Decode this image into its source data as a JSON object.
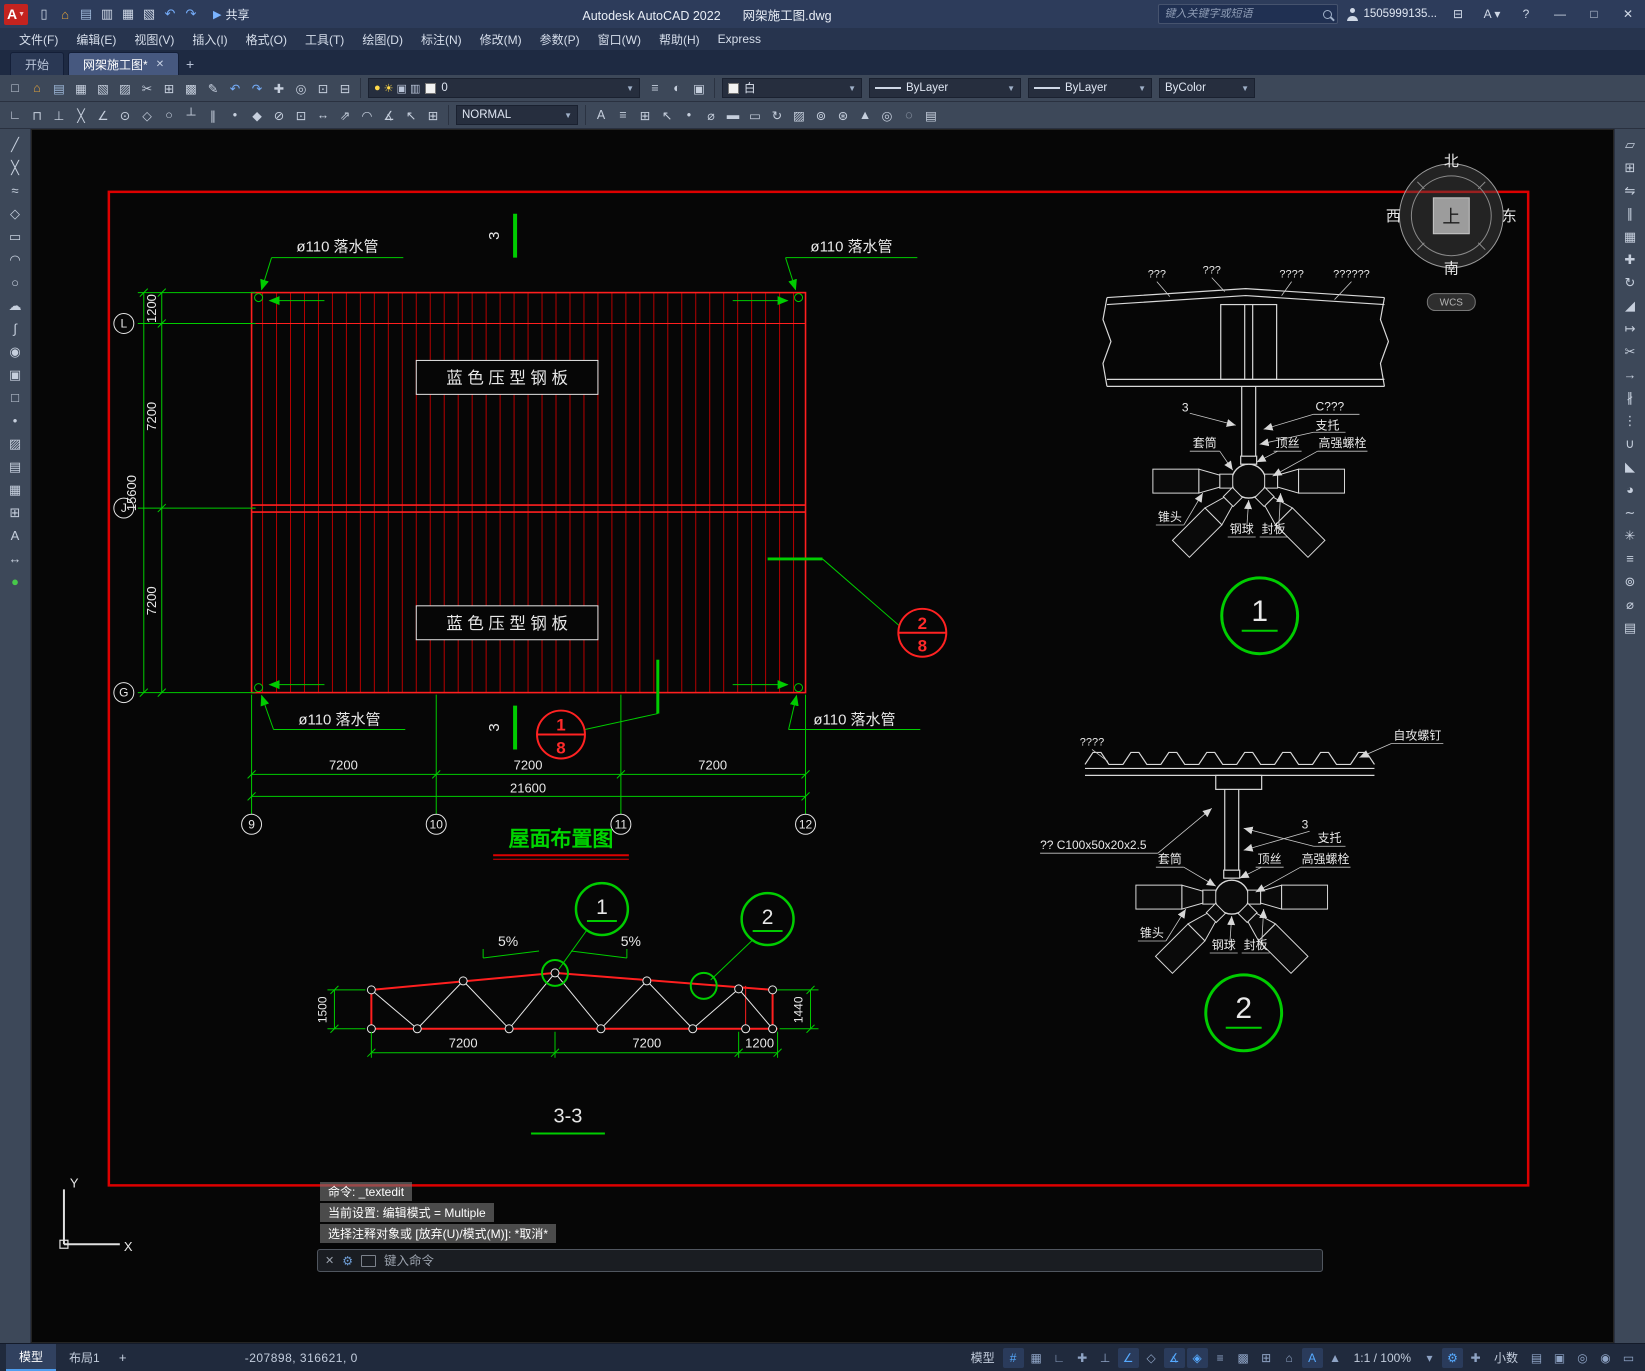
{
  "titlebar": {
    "logo": "A",
    "qat_icons": [
      {
        "name": "qnew-icon",
        "glyph": "▯"
      },
      {
        "name": "open-file-icon",
        "glyph": "⌂",
        "style": "color:#e0a23c"
      },
      {
        "name": "save-icon",
        "glyph": "▤",
        "style": "color:#9db7d8"
      },
      {
        "name": "save-all-icon",
        "glyph": "▥"
      },
      {
        "name": "plot-icon",
        "glyph": "▦"
      },
      {
        "name": "preview-icon",
        "glyph": "▧"
      },
      {
        "name": "undo-icon",
        "glyph": "↶",
        "style": "color:#76aefb"
      },
      {
        "name": "redo-icon",
        "glyph": "↷",
        "style": "color:#76aefb"
      }
    ],
    "share_glyph": "▶",
    "share_label": "共享",
    "app_title": "Autodesk AutoCAD 2022",
    "doc_title": "网架施工图.dwg",
    "search_placeholder": "键入关键字或短语",
    "user_name": "1505999135...",
    "cart_glyph": "⊟",
    "account_label": "A ▾",
    "help_label": "?",
    "minimize_glyph": "—",
    "maximize_glyph": "□",
    "close_glyph": "✕"
  },
  "menubar": {
    "items": [
      {
        "name": "menu-file",
        "label": "文件(F)"
      },
      {
        "name": "menu-edit",
        "label": "编辑(E)"
      },
      {
        "name": "menu-view",
        "label": "视图(V)"
      },
      {
        "name": "menu-insert",
        "label": "插入(I)"
      },
      {
        "name": "menu-format",
        "label": "格式(O)"
      },
      {
        "name": "menu-tools",
        "label": "工具(T)"
      },
      {
        "name": "menu-draw",
        "label": "绘图(D)"
      },
      {
        "name": "menu-dimension",
        "label": "标注(N)"
      },
      {
        "name": "menu-modify",
        "label": "修改(M)"
      },
      {
        "name": "menu-parametric",
        "label": "参数(P)"
      },
      {
        "name": "menu-window",
        "label": "窗口(W)"
      },
      {
        "name": "menu-help",
        "label": "帮助(H)"
      },
      {
        "name": "menu-express",
        "label": "Express"
      }
    ]
  },
  "tabbar": {
    "start_tab": "开始",
    "doc_tab": "网架施工图*",
    "close_glyph": "✕",
    "new_tab_glyph": "+"
  },
  "ribbon": {
    "row1_icons": [
      {
        "name": "new-icon",
        "glyph": "□"
      },
      {
        "name": "open-icon",
        "glyph": "⌂",
        "style": "color:#e0a23c"
      },
      {
        "name": "save-icon",
        "glyph": "▤",
        "style": "color:#9db7d8"
      },
      {
        "name": "plot-icon",
        "glyph": "▦"
      },
      {
        "name": "plot-preview-icon",
        "glyph": "▧"
      },
      {
        "name": "publish-icon",
        "glyph": "▨"
      },
      {
        "name": "cut-icon",
        "glyph": "✂"
      },
      {
        "name": "copy-icon",
        "glyph": "⊞"
      },
      {
        "name": "paste-icon",
        "glyph": "▩"
      },
      {
        "name": "match-properties-icon",
        "glyph": "✎"
      },
      {
        "name": "undo-icon",
        "glyph": "↶",
        "style": "color:#76aefb"
      },
      {
        "name": "redo-icon",
        "glyph": "↷",
        "style": "color:#76aefb"
      },
      {
        "name": "pan-icon",
        "glyph": "✚"
      },
      {
        "name": "zoom-realtime-icon",
        "glyph": "◎"
      },
      {
        "name": "zoom-window-icon",
        "glyph": "⊡"
      },
      {
        "name": "zoom-previous-icon",
        "glyph": "⊟"
      }
    ],
    "layer": {
      "icons": [
        {
          "name": "layer-on-bulb-icon",
          "glyph": "●",
          "style": "color:#ffd94a"
        },
        {
          "name": "layer-thaw-sun-icon",
          "glyph": "☀",
          "style": "color:#ffd94a"
        },
        {
          "name": "layer-lock-icon",
          "glyph": "▣",
          "style": "color:#b9c4d8"
        },
        {
          "name": "layer-plot-icon",
          "glyph": "▥",
          "style": "color:#b9c4d8"
        }
      ],
      "value": "0"
    },
    "row1_after_layer_icons": [
      {
        "name": "layer-properties-icon",
        "glyph": "≡"
      },
      {
        "name": "layer-previous-icon",
        "glyph": "◐"
      },
      {
        "name": "layer-states-icon",
        "glyph": "▣"
      }
    ],
    "color": {
      "value": "白"
    },
    "linetype": {
      "value": "ByLayer"
    },
    "lineweight": {
      "value": "ByLayer"
    },
    "plotstyle": {
      "value": "ByColor"
    },
    "row2_left_icons": [
      {
        "name": "snap-from-icon",
        "glyph": "∟"
      },
      {
        "name": "snap-endpoint-icon",
        "glyph": "⊓"
      },
      {
        "name": "snap-midpoint-icon",
        "glyph": "⊥"
      },
      {
        "name": "snap-intersection-icon",
        "glyph": "╳"
      },
      {
        "name": "snap-extension-icon",
        "glyph": "∠"
      },
      {
        "name": "snap-center-icon",
        "glyph": "⊙"
      },
      {
        "name": "snap-quadrant-icon",
        "glyph": "◇"
      },
      {
        "name": "snap-tangent-icon",
        "glyph": "○"
      },
      {
        "name": "snap-perpendicular-icon",
        "glyph": "┴"
      },
      {
        "name": "snap-parallel-icon",
        "glyph": "∥"
      },
      {
        "name": "snap-node-icon",
        "glyph": "•"
      },
      {
        "name": "snap-nearest-icon",
        "glyph": "◆"
      },
      {
        "name": "snap-none-icon",
        "glyph": "⊘"
      },
      {
        "name": "osnap-settings-icon",
        "glyph": "⊡"
      },
      {
        "name": "dim-linear-icon",
        "glyph": "↔"
      },
      {
        "name": "dim-aligned-icon",
        "glyph": "⇗"
      },
      {
        "name": "dim-radius-icon",
        "glyph": "◠"
      },
      {
        "name": "dim-angular-icon",
        "glyph": "∡"
      },
      {
        "name": "quick-leader-icon",
        "glyph": "↖"
      },
      {
        "name": "tolerance-icon",
        "glyph": "⊞"
      }
    ],
    "annotation": {
      "value": "NORMAL"
    },
    "row2_right_icons": [
      {
        "name": "text-style-icon",
        "glyph": "A"
      },
      {
        "name": "dim-style-icon",
        "glyph": "≡"
      },
      {
        "name": "table-style-icon",
        "glyph": "⊞"
      },
      {
        "name": "mleader-style-icon",
        "glyph": "↖"
      },
      {
        "name": "point-style-icon",
        "glyph": "•"
      },
      {
        "name": "units-icon",
        "glyph": "⌀"
      },
      {
        "name": "thickness-icon",
        "glyph": "▬"
      },
      {
        "name": "drawing-limits-icon",
        "glyph": "▭"
      },
      {
        "name": "regen-icon",
        "glyph": "↻"
      },
      {
        "name": "fill-mode-icon",
        "glyph": "▨"
      },
      {
        "name": "group-icon",
        "glyph": "⊚"
      },
      {
        "name": "ungroup-icon",
        "glyph": "⊛"
      },
      {
        "name": "draw-order-icon",
        "glyph": "▲"
      },
      {
        "name": "isolate-icon",
        "glyph": "◎"
      },
      {
        "name": "hide-objects-icon",
        "glyph": "◌"
      },
      {
        "name": "properties-palette-icon",
        "glyph": "▤"
      }
    ]
  },
  "left_toolbar": {
    "icons": [
      {
        "name": "line-tool-icon",
        "glyph": "╱"
      },
      {
        "name": "construction-line-tool-icon",
        "glyph": "╳"
      },
      {
        "name": "polyline-tool-icon",
        "glyph": "≈"
      },
      {
        "name": "polygon-tool-icon",
        "glyph": "◇"
      },
      {
        "name": "rectangle-tool-icon",
        "glyph": "▭"
      },
      {
        "name": "arc-tool-icon",
        "glyph": "◠"
      },
      {
        "name": "circle-tool-icon",
        "glyph": "○"
      },
      {
        "name": "revision-cloud-tool-icon",
        "glyph": "☁"
      },
      {
        "name": "spline-tool-icon",
        "glyph": "∫"
      },
      {
        "name": "ellipse-tool-icon",
        "glyph": "◉"
      },
      {
        "name": "insert-block-tool-icon",
        "glyph": "▣"
      },
      {
        "name": "create-block-tool-icon",
        "glyph": "□"
      },
      {
        "name": "point-tool-icon",
        "glyph": "•"
      },
      {
        "name": "hatch-tool-icon",
        "glyph": "▨"
      },
      {
        "name": "gradient-tool-icon",
        "glyph": "▤"
      },
      {
        "name": "region-tool-icon",
        "glyph": "▦"
      },
      {
        "name": "table-tool-icon",
        "glyph": "⊞"
      },
      {
        "name": "multiline-text-tool-icon",
        "glyph": "A"
      },
      {
        "name": "dimension-tool-icon",
        "glyph": "↔"
      },
      {
        "name": "color-dot-icon",
        "glyph": "●",
        "style": "color:#47c94a"
      }
    ]
  },
  "right_toolbar": {
    "icons": [
      {
        "name": "erase-tool-icon",
        "glyph": "▱"
      },
      {
        "name": "copy-tool-icon",
        "glyph": "⊞"
      },
      {
        "name": "mirror-tool-icon",
        "glyph": "⇋"
      },
      {
        "name": "offset-tool-icon",
        "glyph": "∥"
      },
      {
        "name": "array-tool-icon",
        "glyph": "▦"
      },
      {
        "name": "move-tool-icon",
        "glyph": "✚"
      },
      {
        "name": "rotate-tool-icon",
        "glyph": "↻"
      },
      {
        "name": "scale-tool-icon",
        "glyph": "◢"
      },
      {
        "name": "stretch-tool-icon",
        "glyph": "↦"
      },
      {
        "name": "trim-tool-icon",
        "glyph": "✂"
      },
      {
        "name": "extend-tool-icon",
        "glyph": "→"
      },
      {
        "name": "break-tool-icon",
        "glyph": "∦"
      },
      {
        "name": "break-at-point-tool-icon",
        "glyph": "⋮"
      },
      {
        "name": "join-tool-icon",
        "glyph": "∪"
      },
      {
        "name": "chamfer-tool-icon",
        "glyph": "◣"
      },
      {
        "name": "fillet-tool-icon",
        "glyph": "◕"
      },
      {
        "name": "blend-tool-icon",
        "glyph": "∼"
      },
      {
        "name": "explode-tool-icon",
        "glyph": "✳"
      },
      {
        "name": "align-tool-icon",
        "glyph": "≡"
      },
      {
        "name": "group-tool-icon",
        "glyph": "⊚"
      },
      {
        "name": "measure-tool-icon",
        "glyph": "⌀"
      },
      {
        "name": "properties-tool-icon",
        "glyph": "▤"
      }
    ]
  },
  "drawing": {
    "plan": {
      "title": "屋面布置图",
      "panel_label": "蓝 色 压 型 钢 板",
      "drain_label": "ø110 落水管",
      "rows": [
        "L",
        "J",
        "G"
      ],
      "cols": [
        "9",
        "10",
        "11",
        "12"
      ],
      "dims_left": [
        "1200",
        "7200",
        "15600",
        "7200"
      ],
      "dims_bottom": [
        "7200",
        "7200",
        "7200"
      ],
      "dim_total": "21600",
      "section_mark": "3",
      "callout_top_num": "2",
      "callout_top_den": "8",
      "callout_bot_num": "1",
      "callout_bot_den": "8"
    },
    "truss": {
      "title": "3-3",
      "slope_left": "5%",
      "slope_right": "5%",
      "dim_left": "1500",
      "dim_right": "1440",
      "dims_bottom": [
        "7200",
        "7200",
        "1200"
      ],
      "bubble1": "1",
      "bubble2": "2"
    },
    "detail1": {
      "bubble": "1",
      "top_labels": [
        "???",
        "???",
        "????",
        "??????"
      ],
      "weld_num": "3",
      "purlin_label": "C???",
      "support": "支托",
      "sleeve": "套筒",
      "screw": "顶丝",
      "bolt": "高强螺栓",
      "cone": "锥头",
      "ball": "钢球",
      "plate": "封板"
    },
    "detail2": {
      "bubble": "2",
      "sheet_label": "????",
      "tapping_screw": "自攻螺钉",
      "purlin_label": "?? C100x50x20x2.5",
      "weld_num": "3",
      "support": "支托",
      "sleeve": "套筒",
      "screw": "顶丝",
      "bolt": "高强螺栓",
      "cone": "锥头",
      "ball": "钢球",
      "plate": "封板"
    },
    "compass": {
      "north": "北",
      "south": "南",
      "west": "西",
      "east": "东",
      "up": "上",
      "wcs": "WCS"
    },
    "ucs": {
      "x": "X",
      "y": "Y"
    }
  },
  "command": {
    "history": [
      "命令: _textedit",
      "当前设置: 编辑模式 = Multiple",
      "选择注释对象或 [放弃(U)/模式(M)]: *取消*"
    ],
    "input_placeholder": "键入命令"
  },
  "statusbar": {
    "model_tab": "模型",
    "layout_tab": "布局1",
    "new_layout_glyph": "+",
    "coords": "-207898, 316621, 0",
    "items": [
      {
        "name": "model-space-toggle",
        "label": "模型",
        "kind": "text"
      },
      {
        "name": "grid-display-icon",
        "glyph": "#",
        "active": true
      },
      {
        "name": "snap-mode-icon",
        "glyph": "▦"
      },
      {
        "name": "infer-constraints-icon",
        "glyph": "∟"
      },
      {
        "name": "dynamic-input-icon",
        "glyph": "✚"
      },
      {
        "name": "ortho-mode-icon",
        "glyph": "⊥"
      },
      {
        "name": "polar-tracking-icon",
        "glyph": "∠",
        "active": true
      },
      {
        "name": "isodraft-icon",
        "glyph": "◇"
      },
      {
        "name": "object-snap-tracking-icon",
        "glyph": "∡",
        "active": true
      },
      {
        "name": "object-snap-icon",
        "glyph": "◈",
        "active": true
      },
      {
        "name": "lineweight-display-icon",
        "glyph": "≡"
      },
      {
        "name": "transparency-icon",
        "glyph": "▩"
      },
      {
        "name": "selection-cycling-icon",
        "glyph": "⊞"
      },
      {
        "name": "dynamic-ucs-icon",
        "glyph": "⌂"
      },
      {
        "name": "annotation-visibility-icon",
        "glyph": "A",
        "active": true
      },
      {
        "name": "autoscale-icon",
        "glyph": "▲"
      },
      {
        "name": "annotation-scale-label",
        "label": "1:1 / 100%",
        "kind": "text"
      },
      {
        "name": "annotation-scale-menu-icon",
        "glyph": "▾"
      },
      {
        "name": "workspace-switching-icon",
        "glyph": "⚙",
        "active": true
      },
      {
        "name": "annotation-monitor-icon",
        "glyph": "✚"
      },
      {
        "name": "units-label",
        "label": "小数",
        "kind": "text"
      },
      {
        "name": "quick-properties-icon",
        "glyph": "▤"
      },
      {
        "name": "lock-ui-icon",
        "glyph": "▣"
      },
      {
        "name": "isolate-objects-icon",
        "glyph": "◎"
      },
      {
        "name": "graphics-performance-icon",
        "glyph": "◉"
      },
      {
        "name": "clean-screen-icon",
        "glyph": "▭"
      }
    ]
  }
}
